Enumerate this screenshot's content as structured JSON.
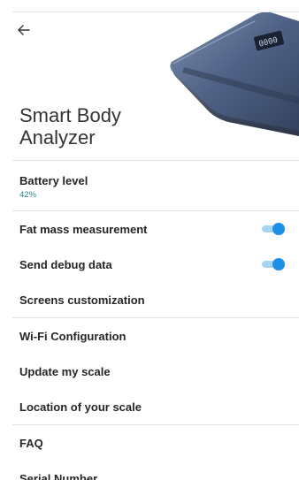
{
  "header": {
    "back_icon": "arrow-left-icon",
    "device_title": "Smart Body Analyzer",
    "scale_display_text": "0000"
  },
  "battery": {
    "label": "Battery level",
    "value": "42%"
  },
  "settings": {
    "fat_mass": {
      "label": "Fat mass measurement",
      "enabled": true
    },
    "debug_data": {
      "label": "Send debug data",
      "enabled": true
    },
    "screens_customization": "Screens customization",
    "wifi_configuration": "Wi-Fi Configuration",
    "update_scale": "Update my scale",
    "location_scale": "Location of your scale",
    "faq": "FAQ",
    "serial_number": "Serial Number"
  },
  "colors": {
    "accent": "#1e8fe6",
    "accent_track": "#a7d4f5",
    "battery_value": "#2b8c9a",
    "divider": "#e3e3e3"
  }
}
